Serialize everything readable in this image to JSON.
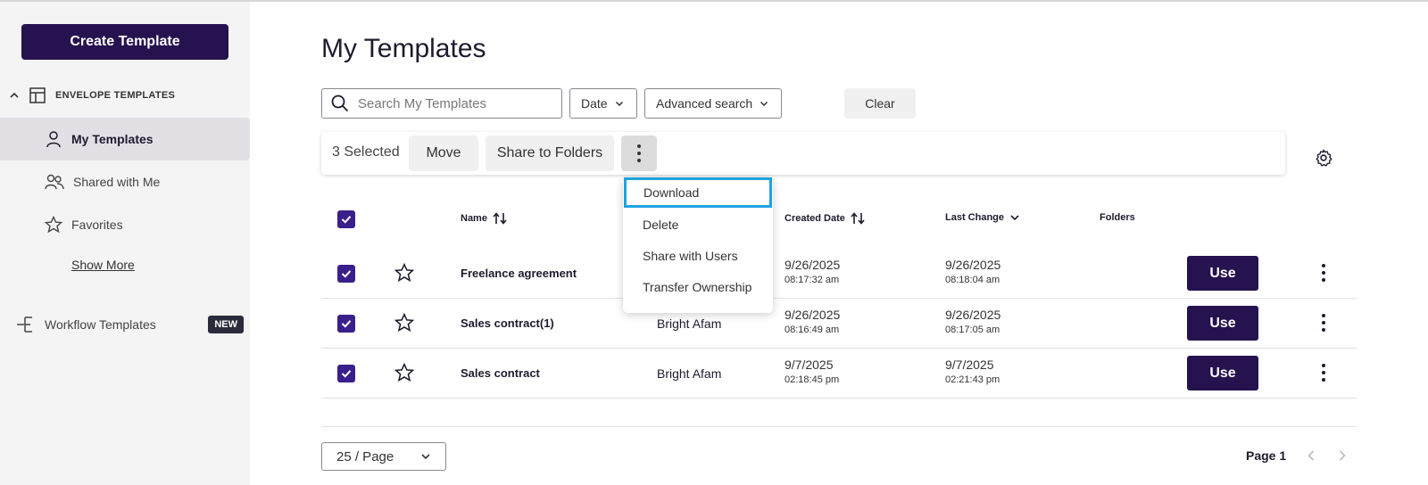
{
  "sidebar": {
    "create_button": "Create Template",
    "section_label": "ENVELOPE TEMPLATES",
    "items": [
      {
        "label": "My Templates",
        "icon": "person-icon",
        "active": true
      },
      {
        "label": "Shared with Me",
        "icon": "people-icon",
        "active": false
      },
      {
        "label": "Favorites",
        "icon": "star-icon",
        "active": false
      }
    ],
    "show_more": "Show More",
    "workflow": {
      "label": "Workflow Templates",
      "badge": "NEW"
    }
  },
  "main": {
    "title": "My Templates",
    "search": {
      "placeholder": "Search My Templates",
      "value": ""
    },
    "date_filter": "Date",
    "advanced_search": "Advanced search",
    "clear": "Clear"
  },
  "selection_bar": {
    "count": "3 Selected",
    "move": "Move",
    "share_to_folders": "Share to Folders"
  },
  "menu": {
    "items": [
      "Download",
      "Delete",
      "Share with Users",
      "Transfer Ownership"
    ],
    "focused_index": 0
  },
  "table": {
    "headers": {
      "name": "Name",
      "created": "Created Date",
      "last_change": "Last Change",
      "folders": "Folders"
    },
    "use_label": "Use",
    "rows": [
      {
        "name": "Freelance agreement",
        "owner": "",
        "created_date": "9/26/2025",
        "created_time": "08:17:32 am",
        "changed_date": "9/26/2025",
        "changed_time": "08:18:04 am"
      },
      {
        "name": "Sales contract(1)",
        "owner": "Bright Afam",
        "created_date": "9/26/2025",
        "created_time": "08:16:49 am",
        "changed_date": "9/26/2025",
        "changed_time": "08:17:05 am"
      },
      {
        "name": "Sales contract",
        "owner": "Bright Afam",
        "created_date": "9/7/2025",
        "created_time": "02:18:45 pm",
        "changed_date": "9/7/2025",
        "changed_time": "02:21:43 pm"
      }
    ]
  },
  "footer": {
    "page_size": "25 / Page",
    "page": "Page 1"
  },
  "colors": {
    "primary": "#26124f",
    "checkbox": "#3a1f8c",
    "focus": "#1ea3e0",
    "sidebar_bg": "#f4f4f4"
  }
}
